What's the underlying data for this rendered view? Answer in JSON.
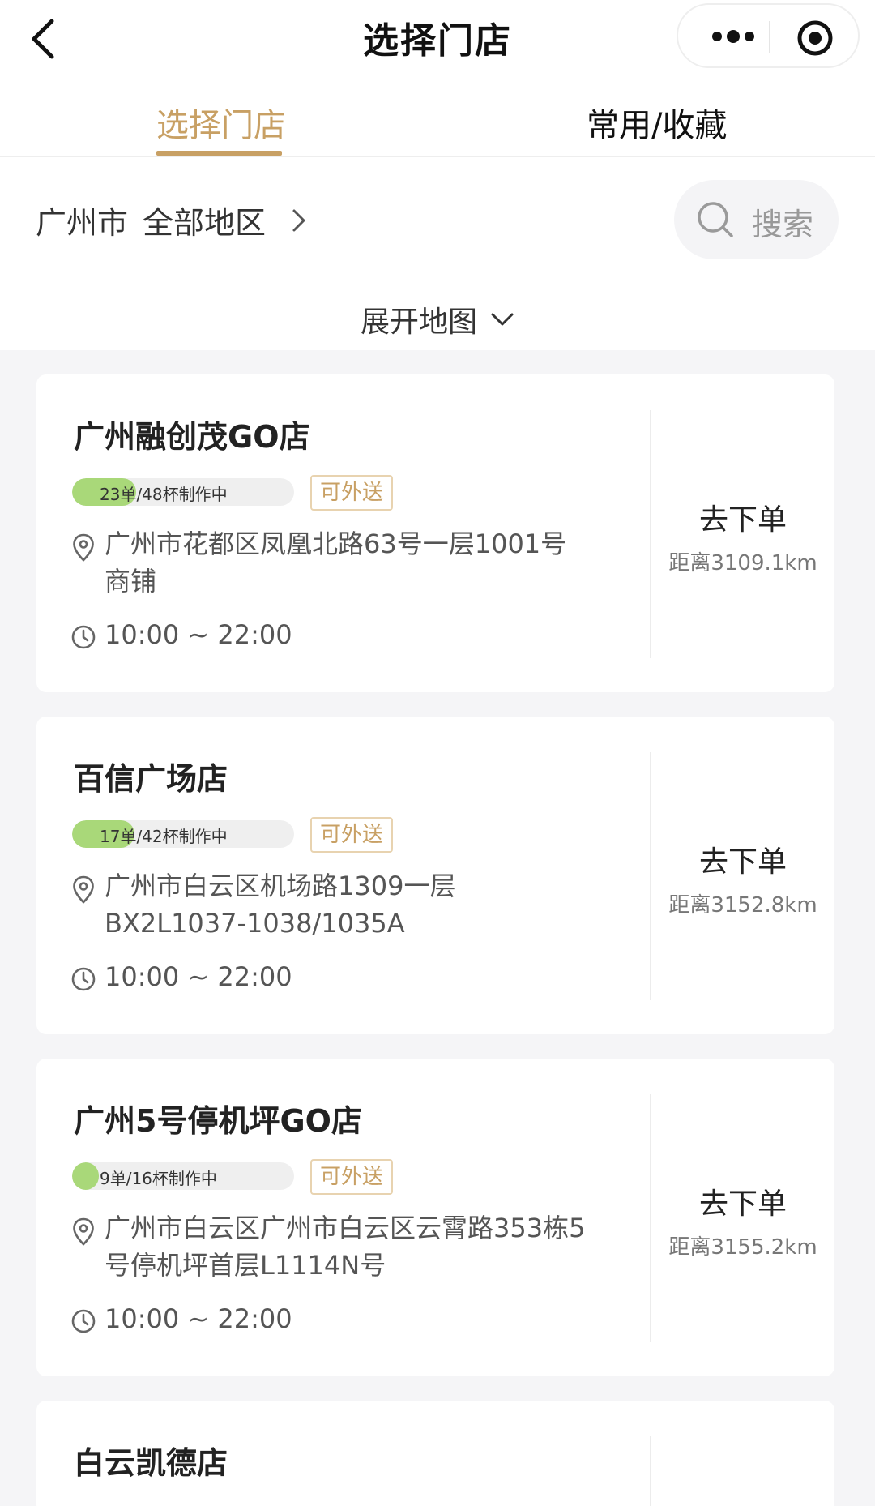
{
  "nav": {
    "title": "选择门店",
    "back_icon": "chevron-left-icon",
    "more_icon": "more-dots-icon",
    "target_icon": "target-circle-icon"
  },
  "tabs": [
    {
      "label": "选择门店",
      "active": true
    },
    {
      "label": "常用/收藏",
      "active": false
    }
  ],
  "filter": {
    "city": "广州市",
    "region": "全部地区",
    "search_placeholder": "搜索"
  },
  "map_toggle": {
    "label": "展开地图"
  },
  "colors": {
    "accent": "#c8a064",
    "progress": "#a9d879",
    "background": "#f5f5f7"
  },
  "stores": [
    {
      "name": "广州融创茂GO店",
      "progress_label": "23单/48杯制作中",
      "progress": 0.29,
      "delivery": "可外送",
      "address": "广州市花都区凤凰北路63号一层1001号商铺",
      "hours": "10:00 ~ 22:00",
      "order_label": "去下单",
      "distance": "距离3109.1km"
    },
    {
      "name": "百信广场店",
      "progress_label": "17单/42杯制作中",
      "progress": 0.28,
      "delivery": "可外送",
      "address": "广州市白云区机场路1309一层BX2L1037-1038/1035A",
      "hours": "10:00 ~ 22:00",
      "order_label": "去下单",
      "distance": "距离3152.8km"
    },
    {
      "name": "广州5号停机坪GO店",
      "progress_label": "9单/16杯制作中",
      "progress": 0.12,
      "delivery": "可外送",
      "address": "广州市白云区广州市白云区云霄路353栋5号停机坪首层L1114N号",
      "hours": "10:00 ~ 22:00",
      "order_label": "去下单",
      "distance": "距离3155.2km"
    },
    {
      "name": "白云凯德店"
    }
  ]
}
